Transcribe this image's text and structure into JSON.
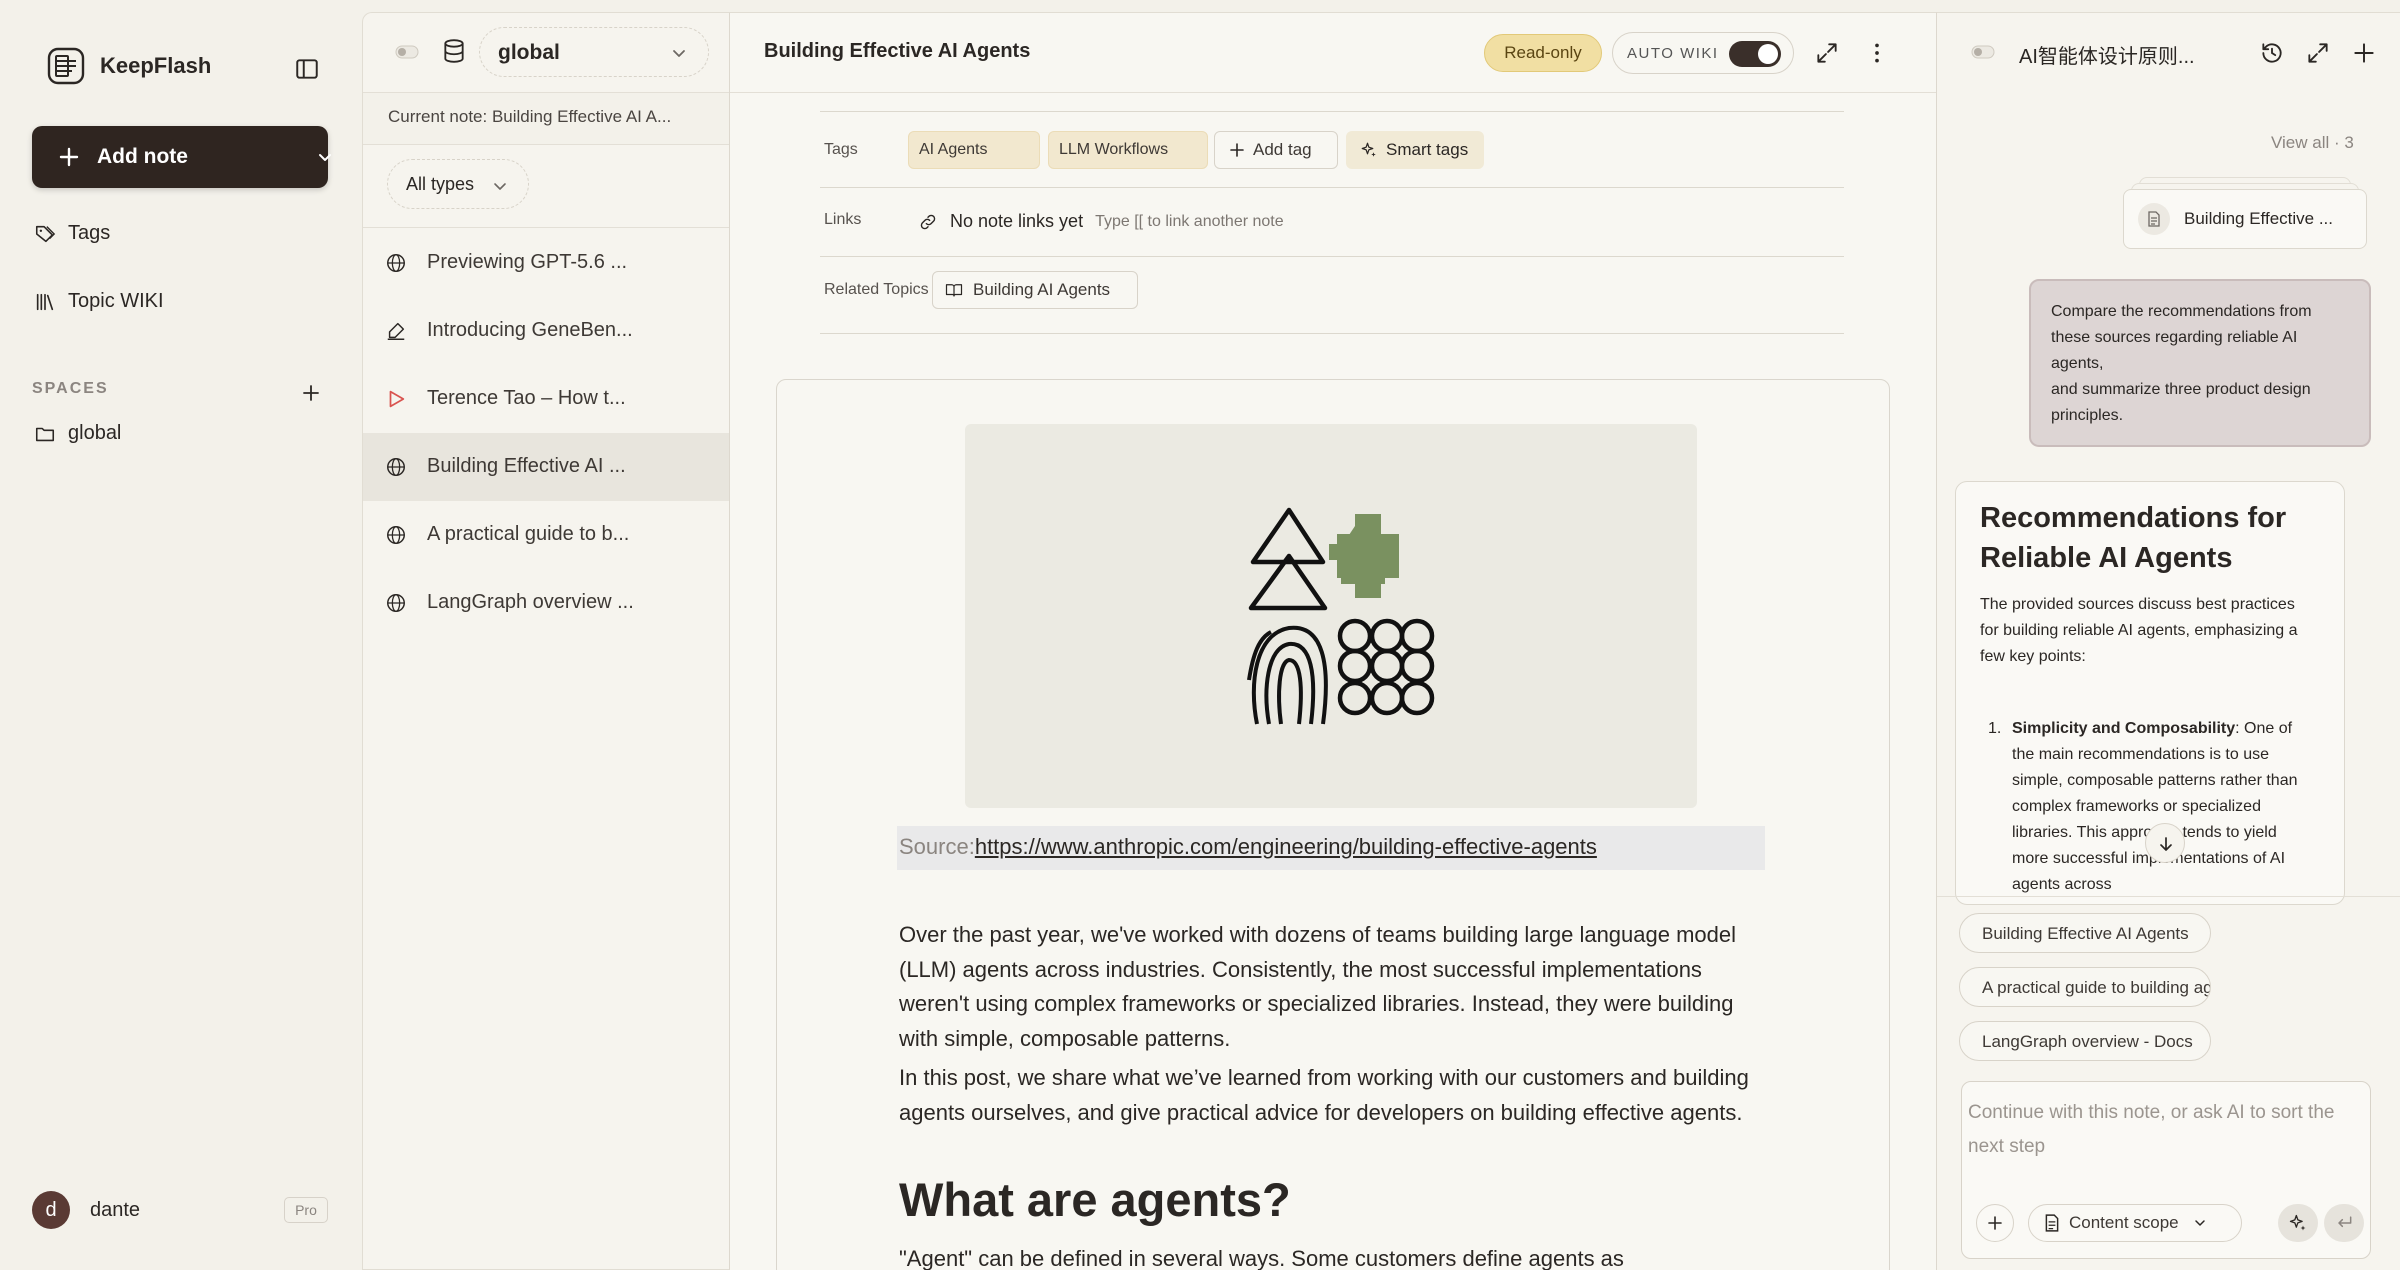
{
  "app": {
    "name": "KeepFlash"
  },
  "sidebar": {
    "add_note_label": "Add note",
    "nav": [
      {
        "label": "Tags",
        "icon": "tags-icon"
      },
      {
        "label": "Topic WIKI",
        "icon": "library-icon"
      }
    ],
    "spaces_title": "SPACES",
    "spaces": [
      {
        "label": "global",
        "icon": "folder-icon"
      }
    ],
    "user": {
      "initial": "d",
      "name": "dante",
      "plan": "Pro"
    }
  },
  "notelist": {
    "space": "global",
    "current_note": "Current note: Building Effective AI A...",
    "type_filter": "All types",
    "notes": [
      {
        "title": "Previewing GPT-5.6 ...",
        "icon": "globe-icon"
      },
      {
        "title": "Introducing GeneBen...",
        "icon": "pen-icon"
      },
      {
        "title": "Terence Tao – How t...",
        "icon": "play-icon"
      },
      {
        "title": "Building Effective AI ...",
        "icon": "globe-icon",
        "active": true
      },
      {
        "title": "A practical guide to b...",
        "icon": "globe-icon"
      },
      {
        "title": "LangGraph overview ...",
        "icon": "globe-icon"
      }
    ]
  },
  "main": {
    "title": "Building Effective AI Agents",
    "readonly": "Read-only",
    "autowiki_label": "AUTO WIKI",
    "autowiki_on": true,
    "tags_label": "Tags",
    "tags": [
      "AI Agents",
      "LLM Workflows"
    ],
    "add_tag": "Add tag",
    "smart_tags": "Smart tags",
    "links_label": "Links",
    "links_empty": "No note links yet",
    "links_hint": "Type [[ to link another note",
    "related_label": "Related Topics",
    "related_topic": "Building AI Agents",
    "source_label": "Source:",
    "source_url": "https://www.anthropic.com/engineering/building-effective-agents",
    "paragraphs": [
      "Over the past year, we've worked with dozens of teams building large language model (LLM) agents across industries. Consistently, the most successful implementations weren't using complex frameworks or specialized libraries. Instead, they were building with simple, composable patterns.",
      "In this post, we share what we’ve learned from working with our customers and building agents ourselves, and give practical advice for developers on building effective agents."
    ],
    "heading": "What are agents?",
    "trailing_text": "\"Agent\" can be defined in several ways. Some customers define agents as"
  },
  "ai": {
    "title": "AI智能体设计原则...",
    "view_all": "View all · 3",
    "source_card": "Building Effective ...",
    "user_message_line1": "Compare the recommendations from these sources regarding reliable AI agents,",
    "user_message_line2": "and summarize three product design principles.",
    "answer_title": "Recommendations for Reliable AI Agents",
    "answer_intro": "The provided sources discuss best practices for building reliable AI agents, emphasizing a few key points:",
    "answer_point_num": "1.",
    "answer_point_bold": "Simplicity and Composability",
    "answer_point_text": ": One of the main recommendations is to use simple, composable patterns rather than complex frameworks or specialized libraries. This approach tends to yield more successful implementations of AI agents across",
    "suggestions": [
      "Building Effective AI Agents",
      "A practical guide to building agents",
      "LangGraph overview - Docs"
    ],
    "input_placeholder": "Continue with this note, or ask AI to sort the next step",
    "scope_label": "Content scope"
  },
  "colors": {
    "accent_dark": "#2f2520",
    "readonly_bg": "#f1dfa3",
    "tag_bg": "#f2e8cf",
    "hero_bg": "#ebeae2",
    "hero_green": "#7a9160",
    "play_red": "#d9534f",
    "user_bubble": "#ddd5d4"
  }
}
